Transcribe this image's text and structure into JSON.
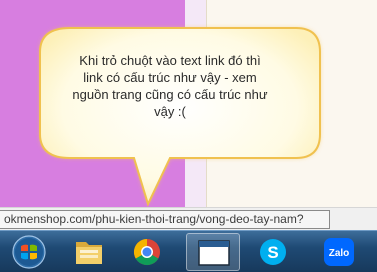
{
  "callout": {
    "line1": "Khi trỏ chuột vào text link đó thì",
    "line2": "link có cấu trúc như vậy - xem",
    "line3": "nguồn trang cũng có cấu trúc như",
    "line4": "vậy :("
  },
  "status_bar": {
    "url": "okmenshop.com/phu-kien-thoi-trang/vong-deo-tay-nam?"
  },
  "taskbar": {
    "items": [
      {
        "icon": "windows-start-icon"
      },
      {
        "icon": "file-explorer-icon"
      },
      {
        "icon": "chrome-icon"
      },
      {
        "icon": "app-window-icon",
        "active": true
      },
      {
        "icon": "skype-icon"
      },
      {
        "icon": "zalo-icon",
        "label": "Zalo"
      }
    ]
  },
  "colors": {
    "purple_panel": "#d77ee0",
    "callout_fill": "#fff9d9",
    "callout_border": "#f3c75e",
    "taskbar": "#1f4a74"
  }
}
